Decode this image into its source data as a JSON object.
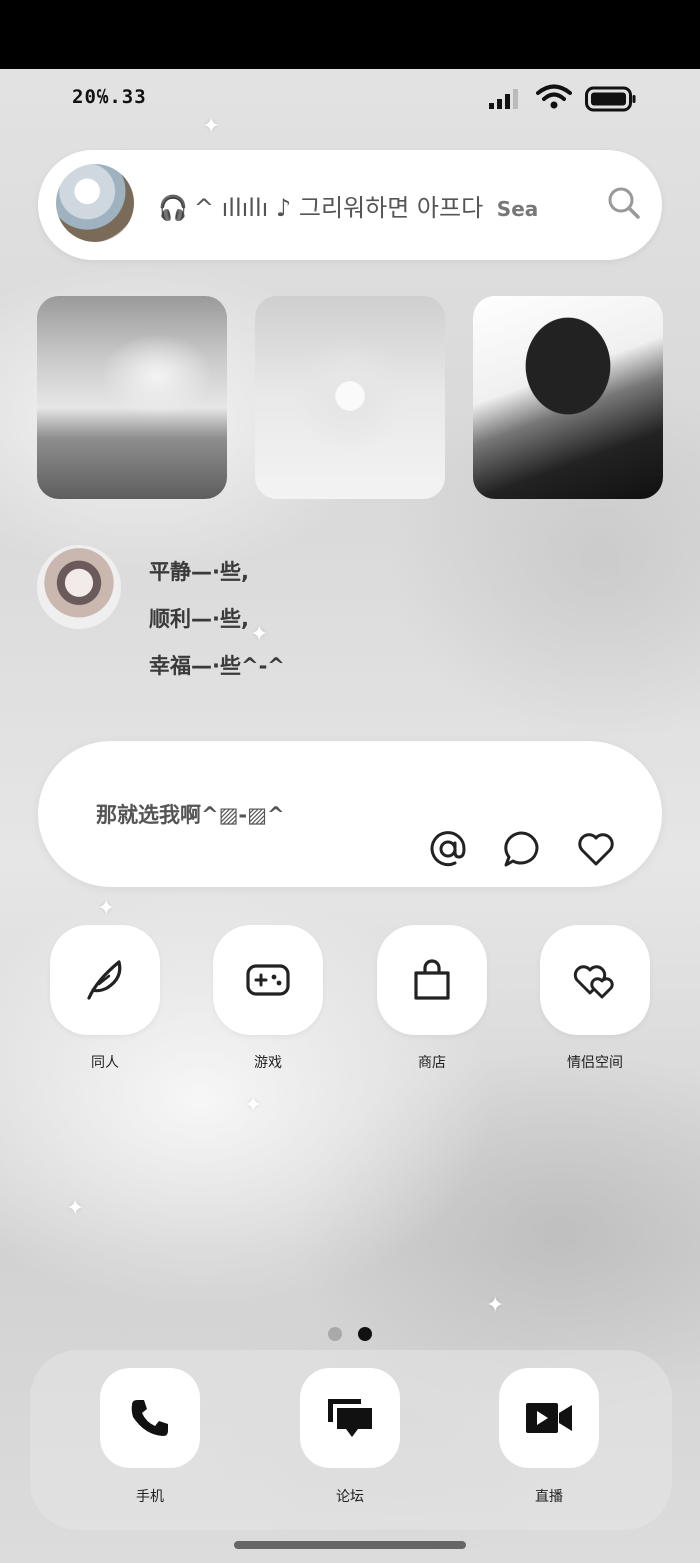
{
  "status_bar": {
    "time": "20℅.33"
  },
  "search_widget": {
    "music_icon": "headphones-icon",
    "now_playing": "^ ıllıllı ♪ 그리워하면 아프다",
    "search_placeholder": "Sea"
  },
  "photos": [
    {
      "name": "photo-snowy-garden"
    },
    {
      "name": "photo-snow-heart"
    },
    {
      "name": "photo-anime-boy"
    }
  ],
  "quote": {
    "lines": [
      "平静—·些,",
      "顺利—·些,",
      "幸福—·些^-^"
    ]
  },
  "message_widget": {
    "text": "那就选我啊^▨-▨^",
    "actions": [
      "at-icon",
      "chat-bubble-icon",
      "heart-icon"
    ]
  },
  "apps": [
    {
      "label": "同人",
      "icon": "feather-icon"
    },
    {
      "label": "游戏",
      "icon": "gamepad-icon"
    },
    {
      "label": "商店",
      "icon": "shopping-bag-icon"
    },
    {
      "label": "情侣空间",
      "icon": "double-heart-icon"
    }
  ],
  "page_indicator": {
    "pages": 2,
    "current": 2
  },
  "dock": [
    {
      "label": "手机",
      "icon": "phone-icon"
    },
    {
      "label": "论坛",
      "icon": "forum-icon"
    },
    {
      "label": "直播",
      "icon": "video-camera-icon"
    }
  ],
  "colors": {
    "widget_bg": "#ffffff",
    "icon": "#222222",
    "text": "#3a3a3a"
  }
}
